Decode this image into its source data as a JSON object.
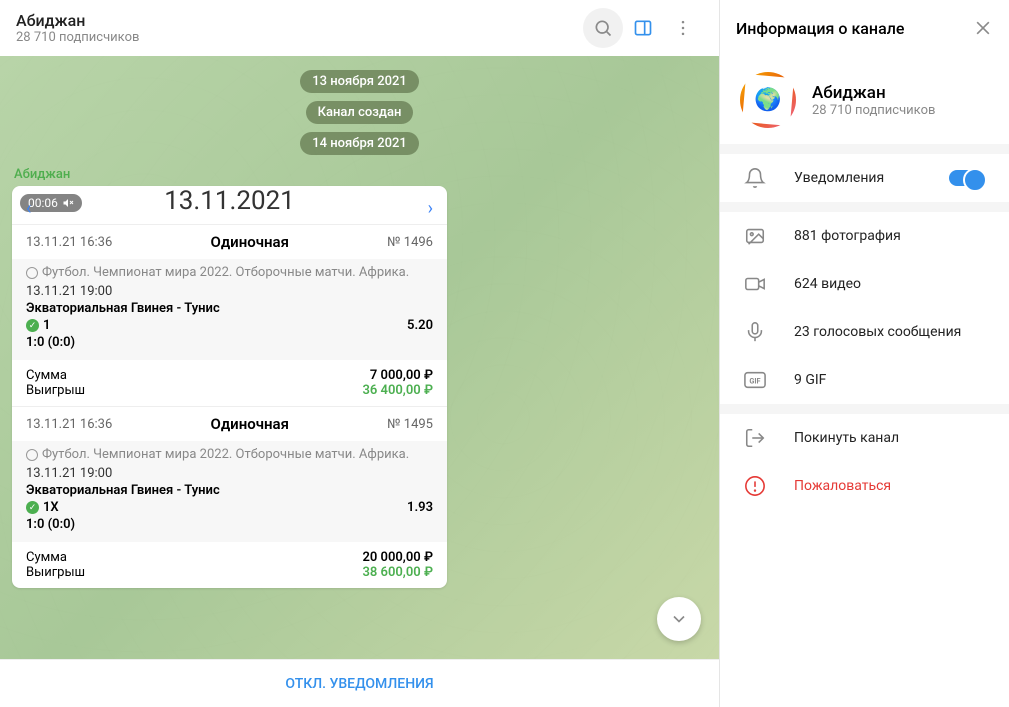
{
  "header": {
    "title": "Абиджан",
    "subtitle": "28 710 подписчиков"
  },
  "chat": {
    "date1": "13 ноября 2021",
    "channel_created": "Канал создан",
    "date2": "14 ноября 2021",
    "author": "Абиджан",
    "video_time": "00:06",
    "bet_header_date": "13.11.2021",
    "bets": [
      {
        "time": "13.11.21 16:36",
        "type": "Одиночная",
        "num": "№ 1496",
        "league": "Футбол. Чемпионат мира 2022. Отборочные матчи. Африка.",
        "match_time": "13.11.21 19:00",
        "match": "Экваториальная Гвинея - Тунис",
        "pick": "1",
        "odds": "5.20",
        "score": "1:0 (0:0)",
        "sum_label": "Сумма",
        "sum_val": "7 000,00 ₽",
        "win_label": "Выигрыш",
        "win_val": "36 400,00 ₽"
      },
      {
        "time": "13.11.21 16:36",
        "type": "Одиночная",
        "num": "№ 1495",
        "league": "Футбол. Чемпионат мира 2022. Отборочные матчи. Африка.",
        "match_time": "13.11.21 19:00",
        "match": "Экваториальная Гвинея - Тунис",
        "pick": "1X",
        "odds": "1.93",
        "score": "1:0 (0:0)",
        "sum_label": "Сумма",
        "sum_val": "20 000,00 ₽",
        "win_label": "Выигрыш",
        "win_val": "38 600,00 ₽"
      }
    ],
    "mute_label": "ОТКЛ. УВЕДОМЛЕНИЯ"
  },
  "sidebar": {
    "title": "Информация о канале",
    "name": "Абиджан",
    "subscribers": "28 710 подписчиков",
    "notifications": "Уведомления",
    "photos": "881 фотография",
    "videos": "624 видео",
    "voice": "23 голосовых сообщения",
    "gif": "9 GIF",
    "leave": "Покинуть канал",
    "report": "Пожаловаться"
  }
}
